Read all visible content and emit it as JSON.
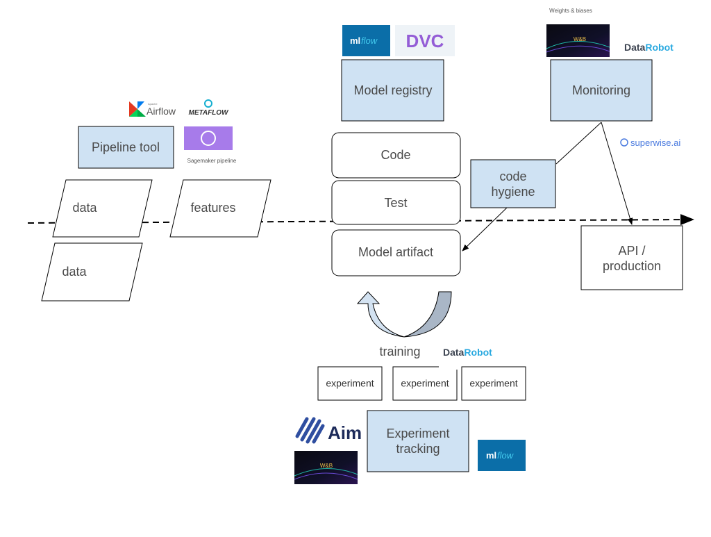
{
  "colors": {
    "box_fill": "#cfe2f3",
    "mlflow_bg": "#0b6ea8",
    "sagemaker": "#a77bea",
    "datarobot_blue": "#29a9e0",
    "wandb_bg": "#0b0b14"
  },
  "pipeline": {
    "title": "Pipeline tool",
    "logos": {
      "airflow_small": "Apache",
      "airflow": "Airflow",
      "metaflow": "METAFLOW",
      "sagemaker_label": "Sagemaker pipeline"
    }
  },
  "inputs": [
    {
      "label": "data"
    },
    {
      "label": "features"
    },
    {
      "label": "data"
    }
  ],
  "registry": {
    "title": "Model registry",
    "logos": {
      "mlflow_ml": "ml",
      "mlflow_flow": "flow",
      "dvc": "DVC"
    }
  },
  "stack": [
    {
      "label": "Code"
    },
    {
      "label": "Test"
    },
    {
      "label": "Model artifact"
    }
  ],
  "hygiene": {
    "line1": "code",
    "line2": "hygiene"
  },
  "monitoring": {
    "title": "Monitoring",
    "caption": "Weights & biases",
    "wandb": "W&B",
    "datarobot_data": "Data",
    "datarobot_robot": "Robot",
    "superwise": "superwise.ai"
  },
  "api": {
    "line1": "API /",
    "line2": "production"
  },
  "training": {
    "label": "training",
    "datarobot_data": "Data",
    "datarobot_robot": "Robot"
  },
  "experiments": [
    {
      "label": "experiment"
    },
    {
      "label": "experiment"
    },
    {
      "label": "experiment"
    }
  ],
  "tracking": {
    "line1": "Experiment",
    "line2": "tracking",
    "aim": "Aim",
    "wandb": "W&B",
    "mlflow_ml": "ml",
    "mlflow_flow": "flow"
  }
}
